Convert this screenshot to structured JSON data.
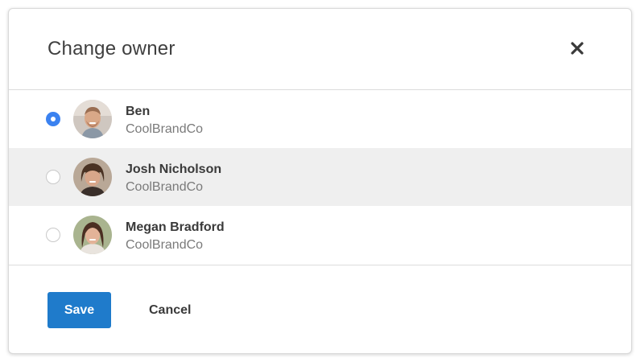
{
  "dialog": {
    "title": "Change owner",
    "close_icon": "close-icon"
  },
  "owners": [
    {
      "name": "Ben",
      "company": "CoolBrandCo",
      "selected": true,
      "highlighted": false
    },
    {
      "name": "Josh Nicholson",
      "company": "CoolBrandCo",
      "selected": false,
      "highlighted": true
    },
    {
      "name": "Megan Bradford",
      "company": "CoolBrandCo",
      "selected": false,
      "highlighted": false
    }
  ],
  "footer": {
    "save_label": "Save",
    "cancel_label": "Cancel"
  },
  "colors": {
    "accent": "#1f7bcb",
    "radio_selected": "#3b82f0",
    "row_highlight": "#efefef"
  }
}
